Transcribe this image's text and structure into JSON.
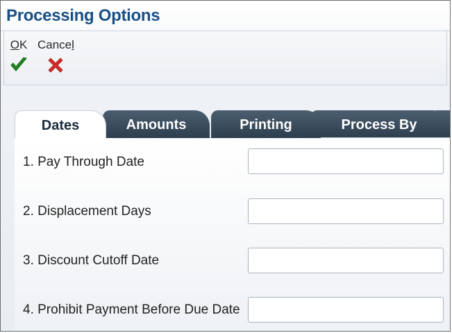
{
  "window": {
    "title": "Processing Options"
  },
  "toolbar": {
    "ok": {
      "mnemonic": "O",
      "rest": "K",
      "icon": "checkmark-icon",
      "color": "#1f8a1f"
    },
    "cancel": {
      "text": "Cance",
      "mnemonic": "l",
      "icon": "x-icon",
      "color": "#d22b2b"
    }
  },
  "tabs": [
    {
      "label": "Dates",
      "active": true
    },
    {
      "label": "Amounts",
      "active": false
    },
    {
      "label": "Printing",
      "active": false
    },
    {
      "label": "Process By",
      "active": false
    },
    {
      "label": "",
      "active": false
    }
  ],
  "fields": [
    {
      "label": "1. Pay Through Date",
      "value": ""
    },
    {
      "label": "2. Displacement Days",
      "value": ""
    },
    {
      "label": "3. Discount Cutoff Date",
      "value": ""
    },
    {
      "label": "4. Prohibit Payment Before Due Date",
      "value": ""
    }
  ],
  "colors": {
    "title": "#1a4f86",
    "tab_inactive": "#3b4d5e",
    "tab_active": "#ffffff"
  }
}
